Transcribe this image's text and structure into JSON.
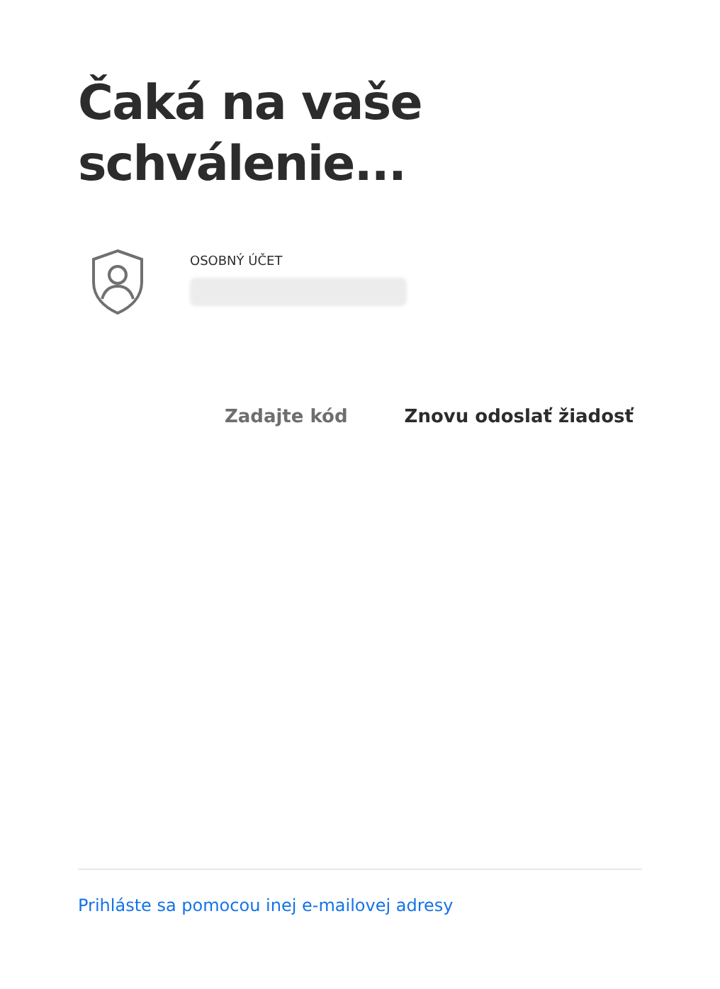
{
  "title": "Čaká na vaše schválenie...",
  "account": {
    "label": "OSOBNÝ ÚČET"
  },
  "actions": [
    {
      "label": "Zadajte kód",
      "kind": "secondary"
    },
    {
      "label": "Znovu odoslať žiadosť",
      "kind": "primary"
    }
  ],
  "footer_link": "Prihláste sa pomocou inej e-mailovej adresy"
}
